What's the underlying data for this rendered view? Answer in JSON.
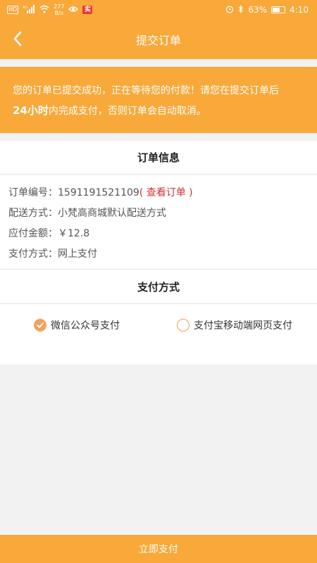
{
  "status_bar": {
    "hd": "HD",
    "network": "4G",
    "speed_value": "277",
    "speed_unit": "B/s",
    "app_badge": "实",
    "battery": "63%",
    "time": "4:10"
  },
  "nav": {
    "title": "提交订单"
  },
  "banner": {
    "line1": "您的订单已提交成功，正在等待您的付款！请您在提交订单后",
    "deadline": "24小时",
    "line2_rest": "内完成支付，否则订单会自动取消。"
  },
  "order_info": {
    "title": "订单信息",
    "number_label": "订单编号：",
    "number_value": "1591191521109",
    "view_order": "( 查看订单 )",
    "delivery_label": "配送方式：",
    "delivery_value": "小梵高商城默认配送方式",
    "amount_label": "应付金额：",
    "amount_value": "￥12.8",
    "pay_type_label": "支付方式：",
    "pay_type_value": "网上支付"
  },
  "payment": {
    "title": "支付方式",
    "options": [
      {
        "label": "微信公众号支付",
        "selected": true
      },
      {
        "label": "支付宝移动端网页支付",
        "selected": false
      }
    ]
  },
  "submit_label": "立即支付",
  "colors": {
    "accent": "#f8a93a",
    "link_red": "#d32f2f"
  }
}
